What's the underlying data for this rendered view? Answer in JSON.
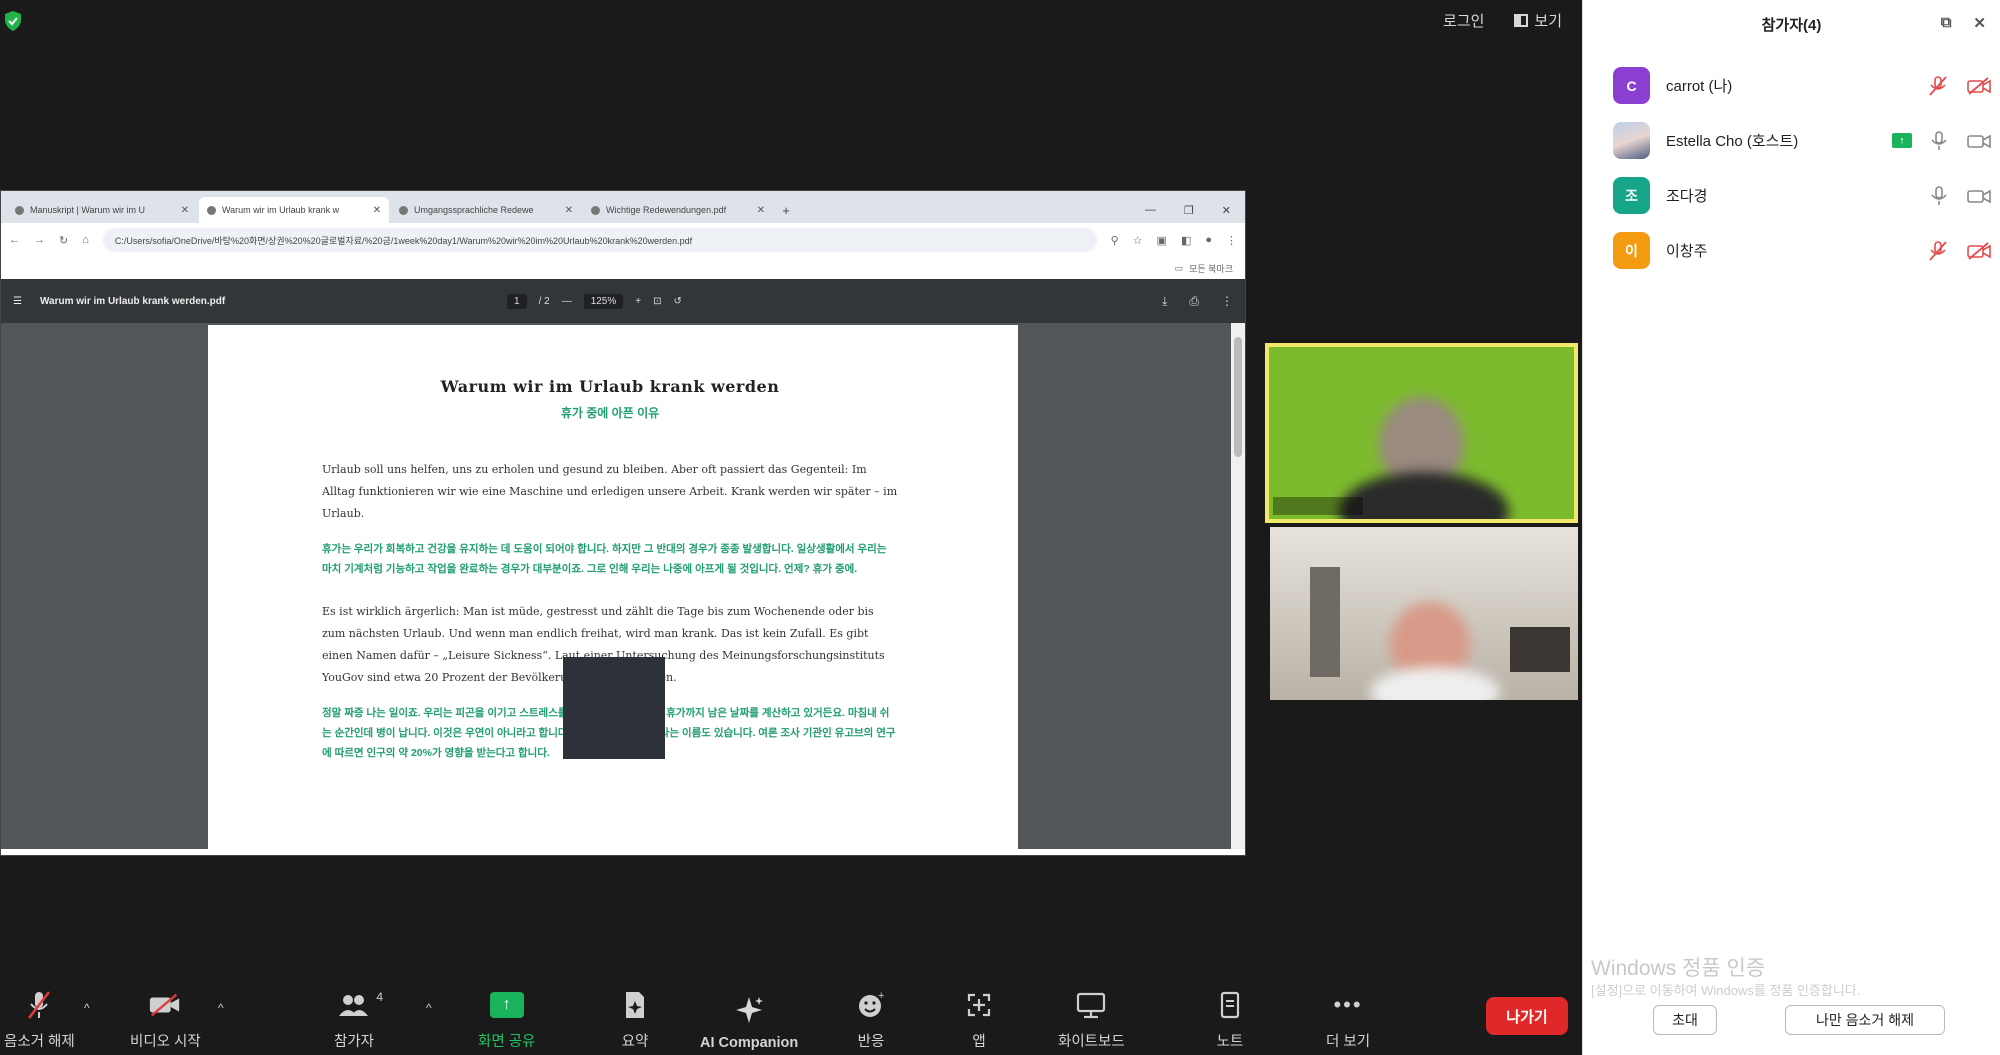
{
  "header": {
    "login_label": "로그인",
    "view_label": "보기"
  },
  "browser": {
    "tabs": [
      {
        "label": "Manuskript | Warum wir im U",
        "active": false
      },
      {
        "label": "Warum wir im Urlaub krank w",
        "active": true
      },
      {
        "label": "Umgangssprachliche Redewe",
        "active": false
      },
      {
        "label": "Wichtige Redewendungen.pdf",
        "active": false
      }
    ],
    "url": "C:/Users/sofia/OneDrive/바탕%20화면/상권%20%20글로벌자료/%20금/1week%20day1/Warum%20wir%20im%20Urlaub%20krank%20werden.pdf",
    "bookmarks_label": "모든 북마크"
  },
  "pdf": {
    "filename": "Warum wir im Urlaub krank werden.pdf",
    "page_current": "1",
    "page_total": "/ 2",
    "zoom": "125%",
    "title": "Warum wir im Urlaub krank werden",
    "subtitle": "휴가 중에 아픈 이유",
    "para_de_1": "Urlaub soll uns helfen, uns zu erholen und gesund zu bleiben. Aber oft passiert das Gegenteil: Im Alltag funktionieren wir wie eine Maschine und erledigen unsere Arbeit. Krank werden wir später – im Urlaub.",
    "para_ko_1": "휴가는 우리가 회복하고 건강을 유지하는 데 도움이 되어야 합니다. 하지만 그 반대의 경우가 종종 발생합니다. 일상생활에서 우리는 마치 기계처럼 기능하고 작업을 완료하는 경우가 대부분이죠. 그로 인해 우리는 나중에 아프게 될 것입니다. 언제? 휴가 중에.",
    "para_de_2": "Es ist wirklich ärgerlich: Man ist müde, gestresst und zählt die Tage bis zum Wochenende oder bis zum nächsten Urlaub. Und wenn man endlich freihat, wird man krank. Das ist kein Zufall. Es gibt einen Namen dafür – „Leisure Sickness“. Laut einer Untersuchung des Meinungsforschungsinstituts YouGov sind etwa 20 Prozent der Bevölkerung davon betroffen.",
    "para_ko_2": "정말 짜증 나는 일이죠. 우리는 피곤을 이기고 스트레스를 받으며 주말이나 다음 휴가까지 남은 날짜를 계산하고 있거든요. 마침내 쉬는 순간인데 병이 납니다. 이것은 우연이 아니라고 합니다. 하물며 \" 여가병 \"이라는 이름도 있습니다. 여론 조사 기관인 유고브의 연구에 따르면 인구의 약 20%가 영향을 받는다고 합니다."
  },
  "toolbar": {
    "mute_label": "음소거 해제",
    "video_label": "비디오 시작",
    "participants_label": "참가자",
    "participants_count": "4",
    "share_label": "화면 공유",
    "summary_label": "요약",
    "ai_label": "AI Companion",
    "react_label": "반응",
    "apps_label": "앱",
    "whiteboard_label": "화이트보드",
    "notes_label": "노트",
    "more_label": "더 보기",
    "leave_label": "나가기"
  },
  "panel": {
    "title": "참가자(4)",
    "participants": [
      {
        "initial": "C",
        "name": "carrot (나)",
        "color": "#8b3fd1"
      },
      {
        "initial": "",
        "name": "Estella Cho (호스트)",
        "color": "#6b7ea8"
      },
      {
        "initial": "조",
        "name": "조다경",
        "color": "#17a589"
      },
      {
        "initial": "이",
        "name": "이창주",
        "color": "#f39c12"
      }
    ],
    "invite_label": "초대",
    "unmute_me_label": "나만 음소거 해제",
    "watermark_title": "Windows 정품 인증",
    "watermark_text": "[설정]으로 이동하여 Windows를 정품 인증합니다."
  }
}
